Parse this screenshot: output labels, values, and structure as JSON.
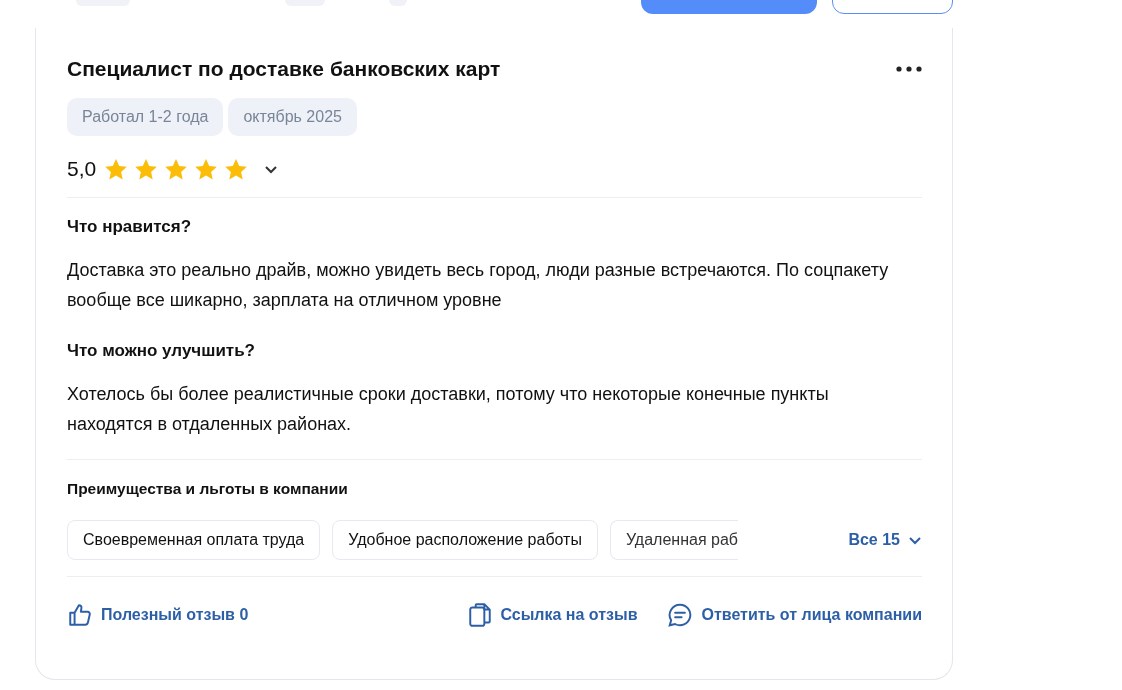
{
  "review": {
    "title": "Специалист по доставке банковских карт",
    "tags": [
      "Работал 1-2 года",
      "октябрь 2025"
    ],
    "rating": "5,0",
    "stars": 5,
    "sections": [
      {
        "heading": "Что нравится?",
        "text": "Доставка это реально драйв, можно увидеть весь город, люди разные встречаются. По соцпакету вообще все шикарно, зарплата на отличном уровне"
      },
      {
        "heading": "Что можно улучшить?",
        "text": "Хотелось бы более реалистичные сроки доставки, потому что некоторые конечные пункты находятся в отдаленных районах."
      }
    ],
    "benefits": {
      "heading": "Преимущества и льготы в компании",
      "items": [
        "Своевременная оплата труда",
        "Удобное расположение работы",
        "Удаленная раб"
      ],
      "more": "Все 15"
    },
    "actions": [
      {
        "kind": "like",
        "label": "Полезный отзыв 0"
      },
      {
        "kind": "link",
        "label": "Ссылка на отзыв"
      },
      {
        "kind": "reply",
        "label": "Ответить от лица компании"
      }
    ]
  }
}
